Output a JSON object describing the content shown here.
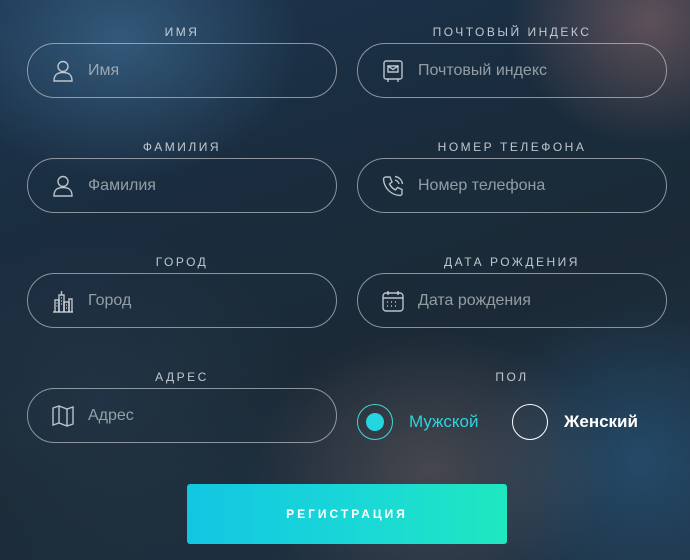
{
  "fields": {
    "first_name": {
      "label": "ИМЯ",
      "placeholder": "Имя",
      "value": ""
    },
    "postal_code": {
      "label": "ПОЧТОВЫЙ ИНДЕКС",
      "placeholder": "Почтовый индекс",
      "value": ""
    },
    "last_name": {
      "label": "ФАМИЛИЯ",
      "placeholder": "Фамилия",
      "value": ""
    },
    "phone": {
      "label": "НОМЕР ТЕЛЕФОНА",
      "placeholder": "Номер телефона",
      "value": ""
    },
    "city": {
      "label": "ГОРОД",
      "placeholder": "Город",
      "value": ""
    },
    "birth_date": {
      "label": "ДАТА РОЖДЕНИЯ",
      "placeholder": "Дата рождения",
      "value": ""
    },
    "address": {
      "label": "АДРЕС",
      "placeholder": "Адрес",
      "value": ""
    }
  },
  "gender": {
    "label": "ПОЛ",
    "options": [
      {
        "label": "Мужской",
        "selected": true
      },
      {
        "label": "Женский",
        "selected": false
      }
    ]
  },
  "icons": {
    "first_name": "user-icon",
    "postal_code": "mailbox-icon",
    "last_name": "user-icon",
    "phone": "phone-icon",
    "city": "city-icon",
    "birth_date": "calendar-icon",
    "address": "map-icon"
  },
  "colors": {
    "accent": "#25d5df",
    "button_gradient_start": "#12c6e2",
    "button_gradient_end": "#1fe8c0"
  },
  "submit": {
    "label": "РЕГИСТРАЦИЯ"
  }
}
